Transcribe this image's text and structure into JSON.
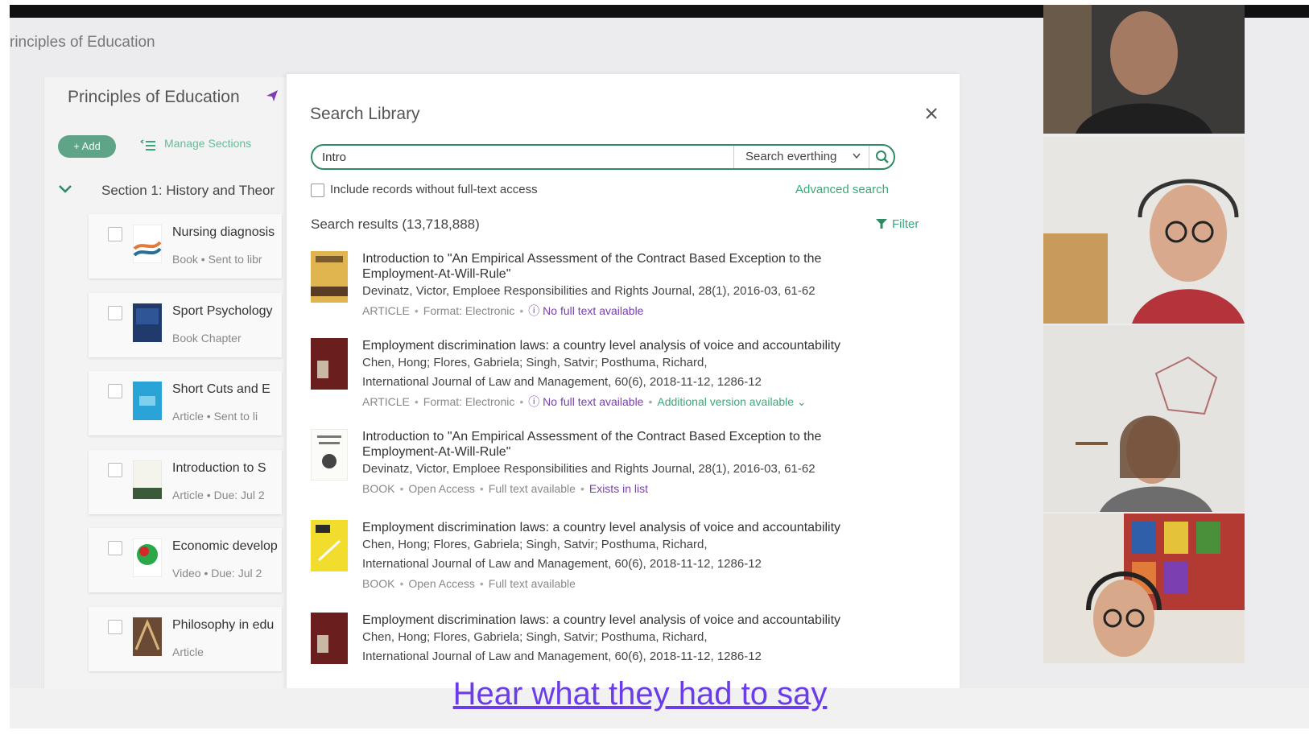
{
  "app": {
    "breadcrumb": "rinciples of Education"
  },
  "list": {
    "title": "Principles of Education",
    "add_label": "+ Add",
    "manage_label": "Manage Sections",
    "section_title": "Section 1: History and Theor",
    "items": [
      {
        "title": "Nursing diagnosis",
        "meta": "Book • Sent to libr"
      },
      {
        "title": "Sport Psychology",
        "meta": "Book Chapter"
      },
      {
        "title": "Short Cuts and E",
        "meta": "Article • Sent to li"
      },
      {
        "title": "Introduction to S",
        "meta": "Article • Due: Jul 2"
      },
      {
        "title": "Economic develop",
        "meta": "Video • Due: Jul 2"
      },
      {
        "title": "Philosophy in edu",
        "meta": "Article"
      }
    ]
  },
  "dialog": {
    "title": "Search Library",
    "search_value": "Intro",
    "scope_label": "Search everthing",
    "include_label": "Include records without full-text access",
    "advanced_label": "Advanced search",
    "results_label": "Search results (13,718,888)",
    "filter_label": "Filter",
    "results": [
      {
        "title": "Introduction to \"An Empirical Assessment of the Contract Based Exception to the Employment-At-Will-Rule\"",
        "authors": "Devinatz, Victor, Emploee Responsibilities and Rights Journal, 28(1), 2016-03, 61-62",
        "source": "",
        "type": "ARTICLE",
        "format": "Format: Electronic",
        "availability": "No full text available",
        "extra": ""
      },
      {
        "title": "Employment discrimination laws: a country level analysis of voice and accountability",
        "authors": "Chen, Hong; Flores, Gabriela; Singh, Satvir; Posthuma, Richard,",
        "source": "International Journal of Law and Management, 60(6), 2018-11-12, 1286-12",
        "type": "ARTICLE",
        "format": "Format: Electronic",
        "availability": "No full text available",
        "extra": "Additional version available"
      },
      {
        "title": "Introduction to \"An Empirical Assessment of the Contract Based Exception to the Employment-At-Will-Rule\"",
        "authors": "Devinatz, Victor, Emploee Responsibilities and Rights Journal, 28(1), 2016-03, 61-62",
        "source": "",
        "type": "BOOK",
        "format": "Open Access",
        "availability": "Full text available",
        "extra": "Exists in list"
      },
      {
        "title": "Employment discrimination laws: a country level analysis of voice and accountability",
        "authors": "Chen, Hong; Flores, Gabriela; Singh, Satvir; Posthuma, Richard,",
        "source": "International Journal of Law and Management, 60(6), 2018-11-12, 1286-12",
        "type": "BOOK",
        "format": "Open Access",
        "availability": "Full text available",
        "extra": ""
      },
      {
        "title": "Employment discrimination laws: a country level analysis of voice and accountability",
        "authors": "Chen, Hong; Flores, Gabriela; Singh, Satvir; Posthuma, Richard,",
        "source": "International Journal of Law and Management, 60(6), 2018-11-12, 1286-12",
        "type": "",
        "format": "",
        "availability": "",
        "extra": ""
      }
    ]
  },
  "caption": "Hear what they had to say",
  "colors": {
    "accent": "#2f8a63",
    "link": "#6a3de8",
    "purple": "#7b3fb1"
  },
  "icons": [
    "send-icon",
    "manage-sections-icon",
    "chevron-down-icon",
    "close-icon",
    "search-icon",
    "filter-icon",
    "info-icon"
  ]
}
